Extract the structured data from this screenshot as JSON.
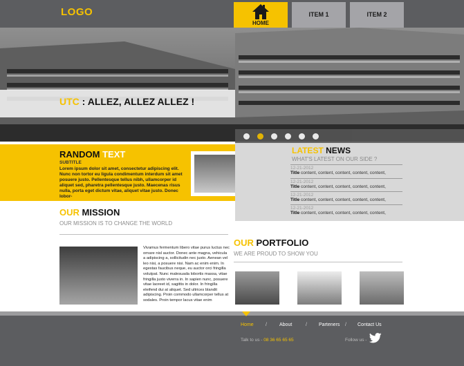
{
  "header": {
    "logo": "LOGO",
    "nav": [
      {
        "label": "HOME",
        "icon": "home-icon",
        "active": true
      },
      {
        "label": "ITEM 1"
      },
      {
        "label": "ITEM 2"
      }
    ]
  },
  "hero": {
    "brand": "UTC",
    "slogan": " : ALLEZ, ALLEZ ALLEZ !",
    "slide_count": 6,
    "active_slide": 2
  },
  "random": {
    "title_a": "RANDOM ",
    "title_b": "TEXT",
    "subtitle": "SUBTITLE",
    "body": "Lorem ipsum dolor sit amet, consectetur adipiscing elit. Nunc non tortor eu ligula condimentum interdum sit amet posuere justo. Pellentesque tellus nibh, ullamcorper id aliquet sed, pharetra pellentesque justo. Maecenas risus nulla, porta eget dictum vitae, aliquet vitae justo. Donec lobor-"
  },
  "news": {
    "title_a": "LATEST ",
    "title_b": "NEWS",
    "subtitle": "WHAT'S LATEST ON OUR SIDE ?",
    "items": [
      {
        "date": "12-21-2012",
        "label": "Title",
        "content": " content, content, content, content, content,"
      },
      {
        "date": "12-21-2012",
        "label": "Title",
        "content": " content, content, content, content, content,"
      },
      {
        "date": "12-21-2012",
        "label": "Title",
        "content": " content, content, content, content, content,"
      },
      {
        "date": "12-21-2012",
        "label": "Title",
        "content": " content, content, content, content, content,"
      }
    ]
  },
  "mission": {
    "title_a": "OUR ",
    "title_b": "MISSION",
    "subtitle": "OUR MISSION IS TO CHANGE THE WORLD",
    "body": "Vivamus fermentum libero vitae purus luctus nec ornare nisl auctor. Donec ante magna, vehicula a adipiscing a, sollicitudin nec justo. Aenean vel leo nisi, a posuere nisi. Nam ac enim enim. In egestas faucibus neque, eu auctor orci fringilla volutpat. Nunc malesuada lobortis massa, vitae fringilla justo viverra in. In sapien nunc, posuere vitae laoreet id, sagittis in dolor. In fringilla eleifend dui at aliquet. Sed ultrices blandit adipiscing. Proin commodo ullamcorper tellus at sodales. Proin tempor lacus vitae enim"
  },
  "portfolio": {
    "title_a": "OUR ",
    "title_b": "PORTFOLIO",
    "subtitle": "WE ARE PROUD TO SHOW YOU"
  },
  "footer": {
    "links": [
      "Home",
      "About",
      "Parteners",
      "Contact Us"
    ],
    "separator": "/",
    "talk_label": "Talk to us - ",
    "phone": "08 36 65 65 65",
    "follow_label": "Follow us -",
    "colors": {
      "accent": "#f6c200",
      "dark": "#5c5d60"
    }
  }
}
